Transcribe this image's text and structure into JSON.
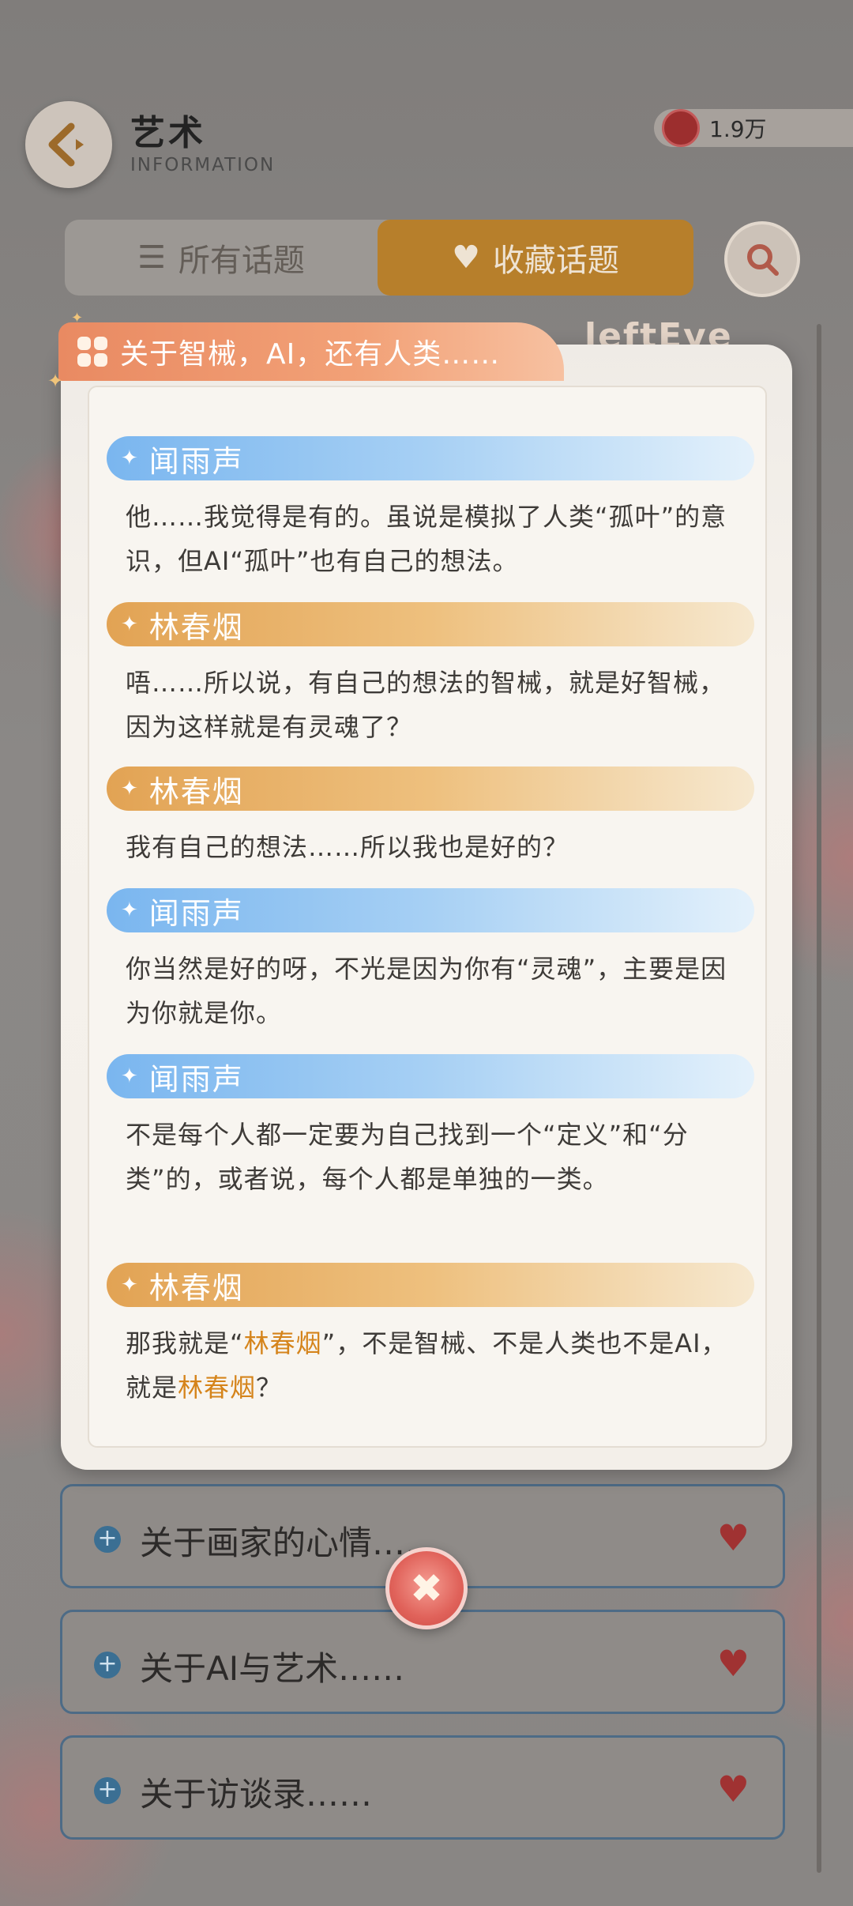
{
  "header": {
    "title": "艺术",
    "subtitle": "INFORMATION",
    "currency_amount": "1.9万"
  },
  "tabs": {
    "all_label": "所有话题",
    "fav_label": "收藏话题",
    "active": "收藏话题"
  },
  "background_strip_text": "leftEye",
  "background_topics": [
    {
      "label": "关于画家的心情……"
    },
    {
      "label": "关于AI与艺术……"
    },
    {
      "label": "关于访谈录……"
    }
  ],
  "modal": {
    "title": "关于智械，AI，还有人类……",
    "dialogues": [
      {
        "speaker": "闻雨声",
        "color": "blue",
        "text": "他……我觉得是有的。虽说是模拟了人类“孤叶”的意识，但AI“孤叶”也有自己的想法。"
      },
      {
        "speaker": "林春烟",
        "color": "orange",
        "text": "唔……所以说，有自己的想法的智械，就是好智械，因为这样就是有灵魂了？"
      },
      {
        "speaker": "林春烟",
        "color": "orange",
        "text": "我有自己的想法……所以我也是好的？"
      },
      {
        "speaker": "闻雨声",
        "color": "blue",
        "text": "你当然是好的呀，不光是因为你有“灵魂”，主要是因为你就是你。"
      },
      {
        "speaker": "闻雨声",
        "color": "blue",
        "text": "不是每个人都一定要为自己找到一个“定义”和“分类”的，或者说，每个人都是单独的一类。"
      },
      {
        "speaker": "林春烟",
        "color": "orange",
        "text_parts": [
          "那我就是“",
          "林春烟",
          "”，不是智械、不是人类也不是AI，就是",
          "林春烟",
          "？"
        ]
      }
    ]
  },
  "colors": {
    "blue_speaker": "#7ab6ef",
    "orange_speaker": "#e2a354",
    "highlight": "#d5841b",
    "close_button": "#e0625a"
  }
}
